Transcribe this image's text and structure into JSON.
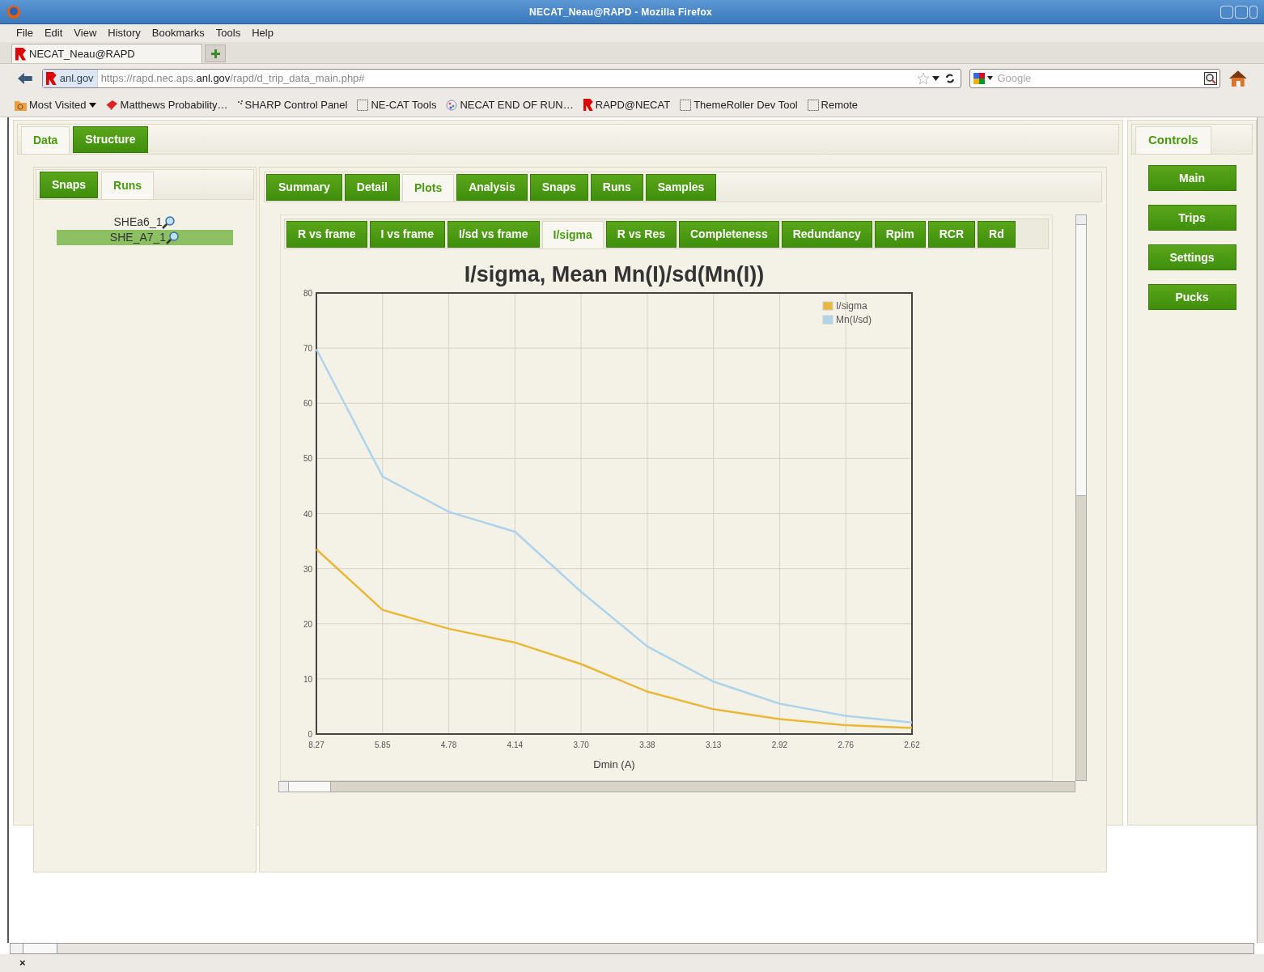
{
  "window": {
    "title": "NECAT_Neau@RAPD - Mozilla Firefox"
  },
  "menu": [
    "File",
    "Edit",
    "View",
    "History",
    "Bookmarks",
    "Tools",
    "Help"
  ],
  "browser_tabs": [
    {
      "label": "NECAT_Neau@RAPD",
      "selected": true
    }
  ],
  "navigation": {
    "site": "anl.gov",
    "url": "https://rapd.nec.aps.**anl.gov**/rapd/d_trip_data_main.php#",
    "search_placeholder": "Google"
  },
  "bookmarks": [
    {
      "label": "Most Visited",
      "kind": "folder"
    },
    {
      "label": "Matthews Probability…",
      "kind": "book"
    },
    {
      "label": "SHARP Control Panel",
      "kind": "dots"
    },
    {
      "label": "NE-CAT Tools",
      "kind": "blank"
    },
    {
      "label": "NECAT END OF RUN…",
      "kind": "globe"
    },
    {
      "label": "RAPD@NECAT",
      "kind": "rapd"
    },
    {
      "label": "ThemeRoller Dev Tool",
      "kind": "blank"
    },
    {
      "label": "Remote",
      "kind": "blank"
    }
  ],
  "main_tabs": [
    {
      "label": "Data",
      "selected": true
    },
    {
      "label": "Structure",
      "selected": false
    }
  ],
  "left_tabs": [
    {
      "label": "Snaps",
      "selected": false
    },
    {
      "label": "Runs",
      "selected": true
    }
  ],
  "runs": [
    {
      "label": "SHEa6_1",
      "selected": false
    },
    {
      "label": "SHE_A7_1",
      "selected": true
    }
  ],
  "sub_tabs": [
    {
      "label": "Summary",
      "selected": false
    },
    {
      "label": "Detail",
      "selected": false
    },
    {
      "label": "Plots",
      "selected": true
    },
    {
      "label": "Analysis",
      "selected": false
    },
    {
      "label": "Snaps",
      "selected": false
    },
    {
      "label": "Runs",
      "selected": false
    },
    {
      "label": "Samples",
      "selected": false
    }
  ],
  "plot_tabs": [
    {
      "label": "R vs frame",
      "selected": false
    },
    {
      "label": "I vs frame",
      "selected": false
    },
    {
      "label": "I/sd vs frame",
      "selected": false
    },
    {
      "label": "I/sigma",
      "selected": true
    },
    {
      "label": "R vs Res",
      "selected": false
    },
    {
      "label": "Completeness",
      "selected": false
    },
    {
      "label": "Redundancy",
      "selected": false
    },
    {
      "label": "Rpim",
      "selected": false
    },
    {
      "label": "RCR",
      "selected": false
    },
    {
      "label": "Rd",
      "selected": false
    }
  ],
  "chart_data": {
    "type": "line",
    "title": "I/sigma, Mean Mn(I)/sd(Mn(I))",
    "xlabel": "Dmin (A)",
    "categories": [
      "8.27",
      "5.85",
      "4.78",
      "4.14",
      "3.70",
      "3.38",
      "3.13",
      "2.92",
      "2.76",
      "2.62"
    ],
    "series": [
      {
        "name": "I/sigma",
        "color": "#eab839",
        "values": [
          33.5,
          22.5,
          19.1,
          16.6,
          12.7,
          7.7,
          4.5,
          2.7,
          1.6,
          1.1
        ]
      },
      {
        "name": "Mn(I/sd)",
        "color": "#aed3ea",
        "values": [
          69.8,
          46.7,
          40.3,
          36.7,
          25.8,
          15.9,
          9.5,
          5.5,
          3.3,
          2.1
        ]
      }
    ],
    "grid": true,
    "legend": "upper right",
    "ylim": [
      0,
      80
    ],
    "yticks": [
      0,
      10,
      20,
      30,
      40,
      50,
      60,
      70,
      80
    ]
  },
  "controls": {
    "tab": "Controls",
    "buttons": [
      "Main",
      "Trips",
      "Settings",
      "Pucks"
    ]
  },
  "status_bar": {
    "close": "×"
  }
}
